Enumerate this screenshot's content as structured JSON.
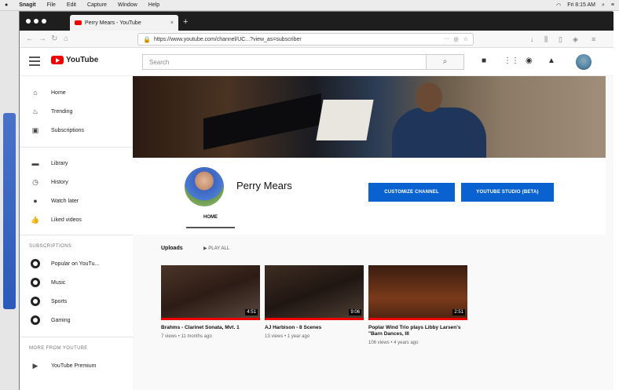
{
  "macmenu": {
    "app": "Snagit",
    "items": [
      "File",
      "Edit",
      "Capture",
      "Window",
      "Help"
    ],
    "clock": "Fri 8:15 AM"
  },
  "browser": {
    "tab_title": "Perry Mears - YouTube",
    "url": "https://www.youtube.com/channel/UC...?view_as=subscriber",
    "close": "×",
    "newtab": "+",
    "lock": "🔒",
    "more": "···"
  },
  "youtube": {
    "brand": "YouTube",
    "search_placeholder": "Search",
    "sidebar": {
      "items": [
        "Home",
        "Trending",
        "Subscriptions",
        "Library",
        "History",
        "Watch later",
        "Liked videos"
      ],
      "subscriptions_header": "SUBSCRIPTIONS",
      "subscriptions": [
        "Popular on YouTu...",
        "Music",
        "Sports",
        "Gaming"
      ],
      "more_header": "MORE FROM YOUTUBE",
      "more": [
        "YouTube Premium"
      ]
    },
    "channel": {
      "name": "Perry Mears",
      "customize": "CUSTOMIZE CHANNEL",
      "studio": "YOUTUBE STUDIO (BETA)",
      "tab_home": "HOME",
      "uploads": "Uploads",
      "play_all": "PLAY ALL"
    },
    "videos": [
      {
        "title": "Brahms - Clarinet Sonata, Mvt. 1",
        "meta": "7 views • 11 months ago",
        "duration": "4:51"
      },
      {
        "title": "AJ Harbison - 8 Scenes",
        "meta": "13 views • 1 year ago",
        "duration": "9:06"
      },
      {
        "title": "Poplar Wind Trio plays Libby Larsen's \"Barn Dances, III",
        "meta": "106 views • 4 years ago",
        "duration": "2:51"
      }
    ]
  }
}
